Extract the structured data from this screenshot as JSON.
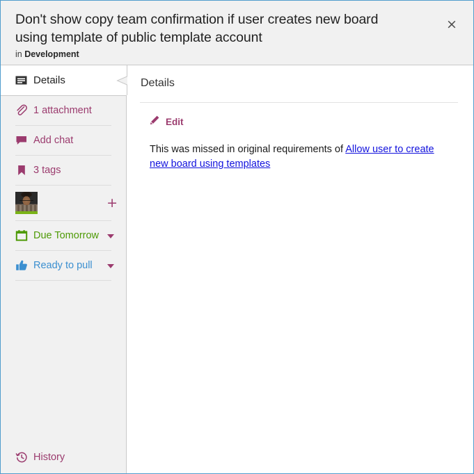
{
  "header": {
    "title": "Don't show copy team confirmation if user creates new board using template of public template account",
    "subtitle_prefix": "in ",
    "board_name": "Development",
    "close_label": "×"
  },
  "sidebar": {
    "active_item": {
      "label": "Details",
      "icon": "details-icon"
    },
    "items": [
      {
        "label": "1 attachment",
        "icon": "paperclip-icon",
        "color": "#9b3b6e",
        "caret": false
      },
      {
        "label": "Add chat",
        "icon": "chat-bubble-icon",
        "color": "#9b3b6e",
        "caret": false
      },
      {
        "label": "3 tags",
        "icon": "tag-bookmark-icon",
        "color": "#9b3b6e",
        "caret": false
      }
    ],
    "members": {
      "add_label": "+",
      "avatar_name": "member-avatar",
      "status_color": "#7ab317"
    },
    "due": {
      "label": "Due Tomorrow",
      "icon": "calendar-icon",
      "color": "#4e9a06",
      "caret": true
    },
    "state": {
      "label": "Ready to pull",
      "icon": "thumbs-up-icon",
      "color": "#3b8fd0",
      "caret": true
    },
    "history": {
      "label": "History",
      "icon": "history-clock-icon",
      "color": "#9b3b6e"
    }
  },
  "main": {
    "heading": "Details",
    "edit_label": "Edit",
    "edit_icon": "pencil-icon",
    "body_text_before_link": "This was missed in original requirements of ",
    "link_text": "Allow user to create new board using templates"
  },
  "colors": {
    "accent_purple": "#9b3b6e",
    "window_border_blue": "#4f9ccd",
    "link_blue": "#1111dd",
    "green": "#4e9a06",
    "blue": "#3b8fd0",
    "header_bg": "#f1f1f1"
  }
}
